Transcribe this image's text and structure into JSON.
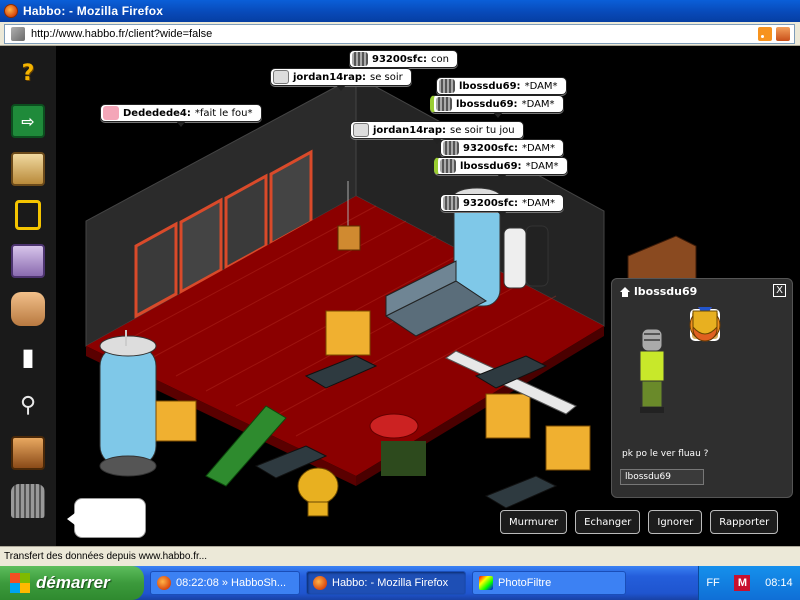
{
  "window": {
    "title": "Habbo: - Mozilla Firefox",
    "url": "http://www.habbo.fr/client?wide=false"
  },
  "toolbar": {
    "icons": [
      "help-icon",
      "exit-room-icon",
      "catalog-icon",
      "navigator-icon",
      "events-icon",
      "hand-inventory-icon",
      "chat-icon",
      "search-icon",
      "room-info-icon",
      "own-avatar-icon"
    ]
  },
  "chat": [
    {
      "user": "93200sfc:",
      "text": "con"
    },
    {
      "user": "jordan14rap:",
      "text": "se soir"
    },
    {
      "user": "lbossdu69:",
      "text": "*DAM*"
    },
    {
      "user": "lbossdu69:",
      "text": "*DAM*"
    },
    {
      "user": "Dededede4:",
      "text": "*fait le fou*"
    },
    {
      "user": "jordan14rap:",
      "text": "se soir tu jou"
    },
    {
      "user": "93200sfc:",
      "text": "*DAM*"
    },
    {
      "user": "lbossdu69:",
      "text": "*DAM*"
    },
    {
      "user": "93200sfc:",
      "text": "*DAM*"
    }
  ],
  "profile": {
    "name": "lbossdu69",
    "motto": "pk po le ver fluau ?",
    "owner": "lbossdu69",
    "close": "X"
  },
  "actions": {
    "whisper": "Murmurer",
    "trade": "Echanger",
    "ignore": "Ignorer",
    "report": "Rapporter"
  },
  "status": "Transfert des données depuis www.habbo.fr...",
  "taskbar": {
    "start": "démarrer",
    "tasks": [
      {
        "label": "08:22:08 » HabboSh..."
      },
      {
        "label": "Habbo: - Mozilla Firefox"
      },
      {
        "label": "PhotoFiltre"
      }
    ],
    "tray_lang": "FF",
    "tray_mcafee": "M",
    "clock": "08:14"
  },
  "colors": {
    "carpet": "#8b0000",
    "window_frame": "#d94a2a",
    "chat_bg": "#ffffff",
    "panel_bg": "#2f2f2f"
  }
}
